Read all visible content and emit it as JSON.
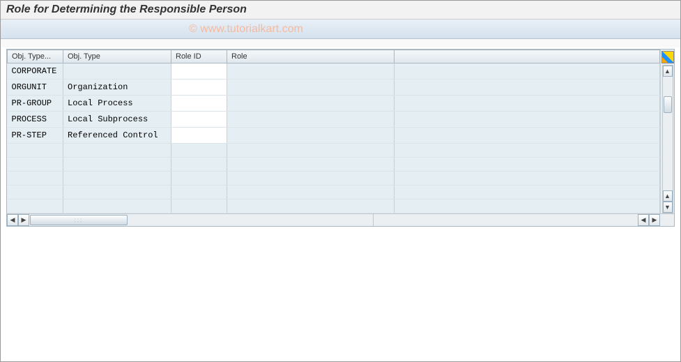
{
  "title": "Role for Determining the Responsible Person",
  "watermark": "© www.tutorialkart.com",
  "table": {
    "columns": [
      {
        "label": "Obj. Type...",
        "key": "type_code"
      },
      {
        "label": "Obj. Type",
        "key": "type_name"
      },
      {
        "label": "Role ID",
        "key": "role_id"
      },
      {
        "label": "Role",
        "key": "role"
      }
    ],
    "rows": [
      {
        "type_code": "CORPORATE",
        "type_name": "",
        "role_id": "",
        "role": ""
      },
      {
        "type_code": "ORGUNIT",
        "type_name": "Organization",
        "role_id": "",
        "role": ""
      },
      {
        "type_code": "PR-GROUP",
        "type_name": "Local Process",
        "role_id": "",
        "role": ""
      },
      {
        "type_code": "PROCESS",
        "type_name": "Local Subprocess",
        "role_id": "",
        "role": ""
      },
      {
        "type_code": "PR-STEP",
        "type_name": "Referenced Control",
        "role_id": "",
        "role": ""
      }
    ]
  },
  "icons": {
    "settings": "table-settings-icon",
    "up": "▲",
    "down": "▼",
    "left": "◀",
    "right": "▶"
  }
}
